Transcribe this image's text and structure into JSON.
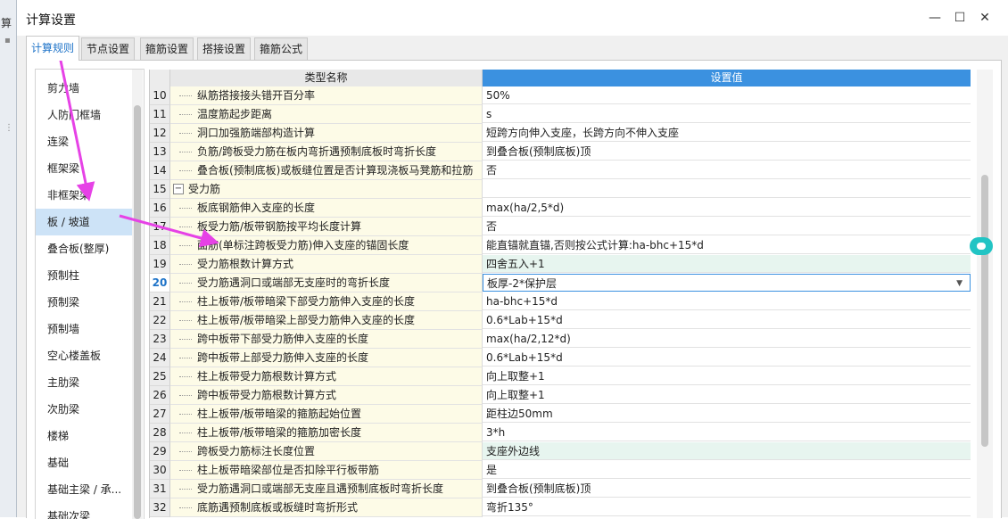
{
  "background": {
    "title_fragment": "算"
  },
  "window": {
    "title": "计算设置",
    "controls": {
      "minimize": "—",
      "maximize": "☐",
      "close": "✕"
    }
  },
  "tabs": [
    {
      "label": "计算规则",
      "active": true
    },
    {
      "label": "节点设置",
      "active": false
    },
    {
      "label": "箍筋设置",
      "active": false
    },
    {
      "label": "搭接设置",
      "active": false
    },
    {
      "label": "箍筋公式",
      "active": false
    }
  ],
  "left_list": {
    "items": [
      "剪力墙",
      "人防门框墙",
      "连梁",
      "框架梁",
      "非框架梁",
      "板 / 坡道",
      "叠合板(整厚)",
      "预制柱",
      "预制梁",
      "预制墙",
      "空心楼盖板",
      "主肋梁",
      "次肋梁",
      "楼梯",
      "基础",
      "基础主梁 / 承...",
      "基础次梁"
    ],
    "selected": "板 / 坡道"
  },
  "grid": {
    "headers": {
      "type_name": "类型名称",
      "setting_value": "设置值"
    },
    "current_row": "20",
    "rows": [
      {
        "num": "10",
        "name": "纵筋搭接接头错开百分率",
        "value": "50%"
      },
      {
        "num": "11",
        "name": "温度筋起步距离",
        "value": "s"
      },
      {
        "num": "12",
        "name": "洞口加强筋端部构造计算",
        "value": "短跨方向伸入支座，长跨方向不伸入支座"
      },
      {
        "num": "13",
        "name": "负筋/跨板受力筋在板内弯折遇预制底板时弯折长度",
        "value": "到叠合板(预制底板)顶"
      },
      {
        "num": "14",
        "name": "叠合板(预制底板)或板缝位置是否计算现浇板马凳筋和拉筋",
        "value": "否"
      },
      {
        "num": "15",
        "name": "受力筋",
        "value": "",
        "group": true,
        "expander": "−"
      },
      {
        "num": "16",
        "name": "板底钢筋伸入支座的长度",
        "value": "max(ha/2,5*d)"
      },
      {
        "num": "17",
        "name": "板受力筋/板带钢筋按平均长度计算",
        "value": "否"
      },
      {
        "num": "18",
        "name": "面筋(单标注跨板受力筋)伸入支座的锚固长度",
        "value": "能直锚就直锚,否则按公式计算:ha-bhc+15*d"
      },
      {
        "num": "19",
        "name": "受力筋根数计算方式",
        "value": "四舍五入+1",
        "green": true
      },
      {
        "num": "20",
        "name": "受力筋遇洞口或端部无支座时的弯折长度",
        "value": "板厚-2*保护层",
        "combo": true,
        "dropdown": "▼"
      },
      {
        "num": "21",
        "name": "柱上板带/板带暗梁下部受力筋伸入支座的长度",
        "value": "ha-bhc+15*d"
      },
      {
        "num": "22",
        "name": "柱上板带/板带暗梁上部受力筋伸入支座的长度",
        "value": "0.6*Lab+15*d"
      },
      {
        "num": "23",
        "name": "跨中板带下部受力筋伸入支座的长度",
        "value": "max(ha/2,12*d)"
      },
      {
        "num": "24",
        "name": "跨中板带上部受力筋伸入支座的长度",
        "value": "0.6*Lab+15*d"
      },
      {
        "num": "25",
        "name": "柱上板带受力筋根数计算方式",
        "value": "向上取整+1"
      },
      {
        "num": "26",
        "name": "跨中板带受力筋根数计算方式",
        "value": "向上取整+1"
      },
      {
        "num": "27",
        "name": "柱上板带/板带暗梁的箍筋起始位置",
        "value": "距柱边50mm"
      },
      {
        "num": "28",
        "name": "柱上板带/板带暗梁的箍筋加密长度",
        "value": "3*h"
      },
      {
        "num": "29",
        "name": "跨板受力筋标注长度位置",
        "value": "支座外边线",
        "green": true
      },
      {
        "num": "30",
        "name": "柱上板带暗梁部位是否扣除平行板带筋",
        "value": "是"
      },
      {
        "num": "31",
        "name": "受力筋遇洞口或端部无支座且遇预制底板时弯折长度",
        "value": "到叠合板(预制底板)顶"
      },
      {
        "num": "32",
        "name": "底筋遇预制底板或板缝时弯折形式",
        "value": "弯折135°"
      }
    ]
  },
  "colors": {
    "accent": "#3b91e0",
    "annotation": "#e642e6",
    "marker": "#22c4c4"
  }
}
